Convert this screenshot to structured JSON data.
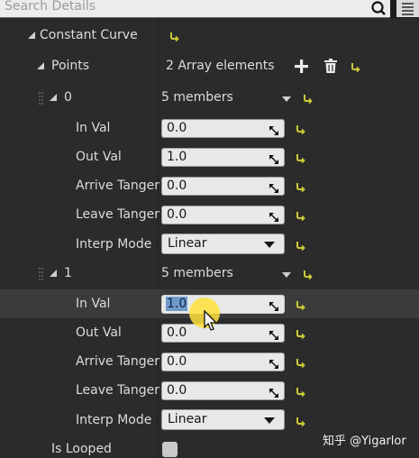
{
  "search": {
    "placeholder": "Search Details"
  },
  "constant_curve": {
    "label": "Constant Curve"
  },
  "points": {
    "label": "Points",
    "value": "2 Array elements"
  },
  "elements": [
    {
      "index": "0",
      "members": "5 members",
      "in_val": {
        "label": "In Val",
        "value": "0.0"
      },
      "out_val": {
        "label": "Out Val",
        "value": "1.0"
      },
      "arrive_tangent": {
        "label": "Arrive Tanger",
        "value": "0.0"
      },
      "leave_tangent": {
        "label": "Leave Tanger",
        "value": "0.0"
      },
      "interp_mode": {
        "label": "Interp Mode",
        "value": "Linear"
      }
    },
    {
      "index": "1",
      "members": "5 members",
      "in_val": {
        "label": "In Val",
        "value": "1.0"
      },
      "out_val": {
        "label": "Out Val",
        "value": "0.0"
      },
      "arrive_tangent": {
        "label": "Arrive Tanger",
        "value": "0.0"
      },
      "leave_tangent": {
        "label": "Leave Tanger",
        "value": "0.0"
      },
      "interp_mode": {
        "label": "Interp Mode",
        "value": "Linear"
      }
    }
  ],
  "is_looped": {
    "label": "Is Looped",
    "checked": false
  },
  "watermark": "知乎 @Yigarlor",
  "icons": {
    "search": "search-icon",
    "add": "add-icon",
    "delete": "trash-icon",
    "reset": "reset-arrow-icon",
    "expand": "expand-triangle-icon"
  },
  "colors": {
    "panel_bg": "#2b2b2b",
    "reset_icon": "#c9c93a",
    "selection": "#6f99c9",
    "cursor_highlight": "#ffe23c"
  }
}
